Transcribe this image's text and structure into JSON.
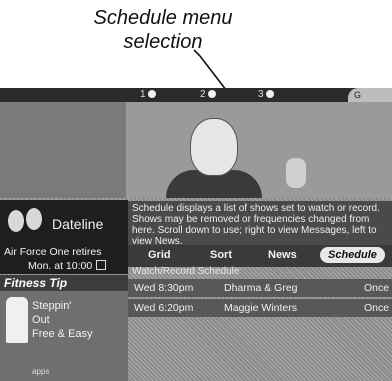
{
  "callout": {
    "line1": "Schedule menu",
    "line2": "selection"
  },
  "top_bar": {
    "channels": [
      {
        "label": "1"
      },
      {
        "label": "2"
      },
      {
        "label": "3"
      }
    ],
    "logo_text": "G"
  },
  "show": {
    "title": "Dateline",
    "subtitle": "Air Force One retires",
    "time": "Mon. at 10:00"
  },
  "fitness_tip": {
    "heading": "Fitness Tip",
    "lines": [
      "Steppin'",
      "Out",
      "Free & Easy"
    ],
    "footer": "apps"
  },
  "description": "Schedule displays a list of shows set to watch or record. Shows may be removed or frequencies changed from here. Scroll down to use; right to view Messages, left to view News.",
  "menu": {
    "items": [
      {
        "label": "Grid"
      },
      {
        "label": "Sort"
      },
      {
        "label": "News"
      },
      {
        "label": "Schedule"
      }
    ],
    "selected": "Schedule"
  },
  "schedule": {
    "section_label": "Watch/Record Schedule",
    "rows": [
      {
        "time": "Wed 8:30pm",
        "title": "Dharma & Greg",
        "frequency": "Once"
      },
      {
        "time": "Wed 6:20pm",
        "title": "Maggie Winters",
        "frequency": "Once"
      }
    ]
  }
}
